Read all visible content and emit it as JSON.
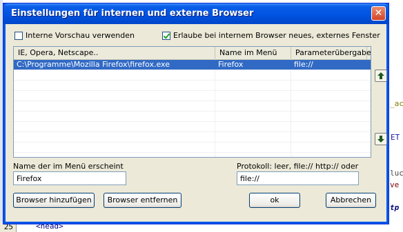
{
  "window": {
    "title": "Einstellungen für internen und externe Browser"
  },
  "options": {
    "internal_preview": {
      "label": "Interne Vorschau verwenden",
      "checked": false
    },
    "allow_external": {
      "label": "Erlaube bei internem Browser neues, externes Fenster",
      "checked": true
    }
  },
  "browser_list": {
    "columns": [
      "IE, Opera, Netscape..",
      "Name im Menü",
      "Parameterübergabe"
    ],
    "rows": [
      {
        "path": "C:\\Programme\\Mozilla Firefox\\firefox.exe",
        "name": "Firefox",
        "param": "file://"
      }
    ]
  },
  "fields": {
    "menu_name": {
      "label": "Name der im Menü erscheint",
      "value": "Firefox"
    },
    "protocol": {
      "label": "Protokoll: leer, file:// http:// oder https://",
      "value": "file://"
    }
  },
  "buttons": {
    "add": "Browser hinzufügen",
    "remove": "Browser entfernen",
    "ok": "ok",
    "cancel": "Abbrechen"
  },
  "background": {
    "line_number": "25",
    "code_head": "<head>",
    "frag_ac": "_ac",
    "frag_et": "ET",
    "frag_luc": "luc",
    "frag_ve": "ve",
    "frag_tp": "tp"
  },
  "colors": {
    "titlebar": "#0052e0",
    "selection": "#316ac5",
    "dialog_bg": "#ece9d8"
  }
}
